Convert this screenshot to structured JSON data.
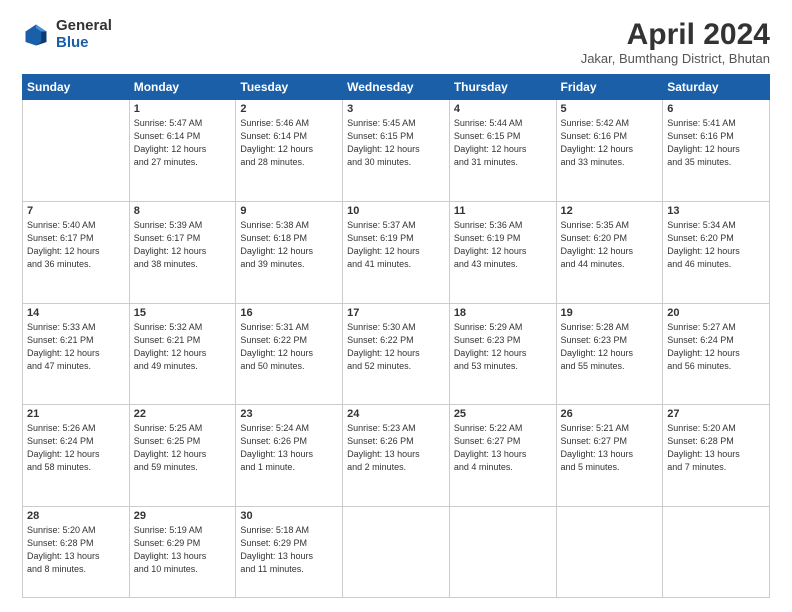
{
  "logo": {
    "general": "General",
    "blue": "Blue"
  },
  "header": {
    "month": "April 2024",
    "location": "Jakar, Bumthang District, Bhutan"
  },
  "weekdays": [
    "Sunday",
    "Monday",
    "Tuesday",
    "Wednesday",
    "Thursday",
    "Friday",
    "Saturday"
  ],
  "weeks": [
    [
      {
        "day": "",
        "info": ""
      },
      {
        "day": "1",
        "info": "Sunrise: 5:47 AM\nSunset: 6:14 PM\nDaylight: 12 hours\nand 27 minutes."
      },
      {
        "day": "2",
        "info": "Sunrise: 5:46 AM\nSunset: 6:14 PM\nDaylight: 12 hours\nand 28 minutes."
      },
      {
        "day": "3",
        "info": "Sunrise: 5:45 AM\nSunset: 6:15 PM\nDaylight: 12 hours\nand 30 minutes."
      },
      {
        "day": "4",
        "info": "Sunrise: 5:44 AM\nSunset: 6:15 PM\nDaylight: 12 hours\nand 31 minutes."
      },
      {
        "day": "5",
        "info": "Sunrise: 5:42 AM\nSunset: 6:16 PM\nDaylight: 12 hours\nand 33 minutes."
      },
      {
        "day": "6",
        "info": "Sunrise: 5:41 AM\nSunset: 6:16 PM\nDaylight: 12 hours\nand 35 minutes."
      }
    ],
    [
      {
        "day": "7",
        "info": "Sunrise: 5:40 AM\nSunset: 6:17 PM\nDaylight: 12 hours\nand 36 minutes."
      },
      {
        "day": "8",
        "info": "Sunrise: 5:39 AM\nSunset: 6:17 PM\nDaylight: 12 hours\nand 38 minutes."
      },
      {
        "day": "9",
        "info": "Sunrise: 5:38 AM\nSunset: 6:18 PM\nDaylight: 12 hours\nand 39 minutes."
      },
      {
        "day": "10",
        "info": "Sunrise: 5:37 AM\nSunset: 6:19 PM\nDaylight: 12 hours\nand 41 minutes."
      },
      {
        "day": "11",
        "info": "Sunrise: 5:36 AM\nSunset: 6:19 PM\nDaylight: 12 hours\nand 43 minutes."
      },
      {
        "day": "12",
        "info": "Sunrise: 5:35 AM\nSunset: 6:20 PM\nDaylight: 12 hours\nand 44 minutes."
      },
      {
        "day": "13",
        "info": "Sunrise: 5:34 AM\nSunset: 6:20 PM\nDaylight: 12 hours\nand 46 minutes."
      }
    ],
    [
      {
        "day": "14",
        "info": "Sunrise: 5:33 AM\nSunset: 6:21 PM\nDaylight: 12 hours\nand 47 minutes."
      },
      {
        "day": "15",
        "info": "Sunrise: 5:32 AM\nSunset: 6:21 PM\nDaylight: 12 hours\nand 49 minutes."
      },
      {
        "day": "16",
        "info": "Sunrise: 5:31 AM\nSunset: 6:22 PM\nDaylight: 12 hours\nand 50 minutes."
      },
      {
        "day": "17",
        "info": "Sunrise: 5:30 AM\nSunset: 6:22 PM\nDaylight: 12 hours\nand 52 minutes."
      },
      {
        "day": "18",
        "info": "Sunrise: 5:29 AM\nSunset: 6:23 PM\nDaylight: 12 hours\nand 53 minutes."
      },
      {
        "day": "19",
        "info": "Sunrise: 5:28 AM\nSunset: 6:23 PM\nDaylight: 12 hours\nand 55 minutes."
      },
      {
        "day": "20",
        "info": "Sunrise: 5:27 AM\nSunset: 6:24 PM\nDaylight: 12 hours\nand 56 minutes."
      }
    ],
    [
      {
        "day": "21",
        "info": "Sunrise: 5:26 AM\nSunset: 6:24 PM\nDaylight: 12 hours\nand 58 minutes."
      },
      {
        "day": "22",
        "info": "Sunrise: 5:25 AM\nSunset: 6:25 PM\nDaylight: 12 hours\nand 59 minutes."
      },
      {
        "day": "23",
        "info": "Sunrise: 5:24 AM\nSunset: 6:26 PM\nDaylight: 13 hours\nand 1 minute."
      },
      {
        "day": "24",
        "info": "Sunrise: 5:23 AM\nSunset: 6:26 PM\nDaylight: 13 hours\nand 2 minutes."
      },
      {
        "day": "25",
        "info": "Sunrise: 5:22 AM\nSunset: 6:27 PM\nDaylight: 13 hours\nand 4 minutes."
      },
      {
        "day": "26",
        "info": "Sunrise: 5:21 AM\nSunset: 6:27 PM\nDaylight: 13 hours\nand 5 minutes."
      },
      {
        "day": "27",
        "info": "Sunrise: 5:20 AM\nSunset: 6:28 PM\nDaylight: 13 hours\nand 7 minutes."
      }
    ],
    [
      {
        "day": "28",
        "info": "Sunrise: 5:20 AM\nSunset: 6:28 PM\nDaylight: 13 hours\nand 8 minutes."
      },
      {
        "day": "29",
        "info": "Sunrise: 5:19 AM\nSunset: 6:29 PM\nDaylight: 13 hours\nand 10 minutes."
      },
      {
        "day": "30",
        "info": "Sunrise: 5:18 AM\nSunset: 6:29 PM\nDaylight: 13 hours\nand 11 minutes."
      },
      {
        "day": "",
        "info": ""
      },
      {
        "day": "",
        "info": ""
      },
      {
        "day": "",
        "info": ""
      },
      {
        "day": "",
        "info": ""
      }
    ]
  ]
}
